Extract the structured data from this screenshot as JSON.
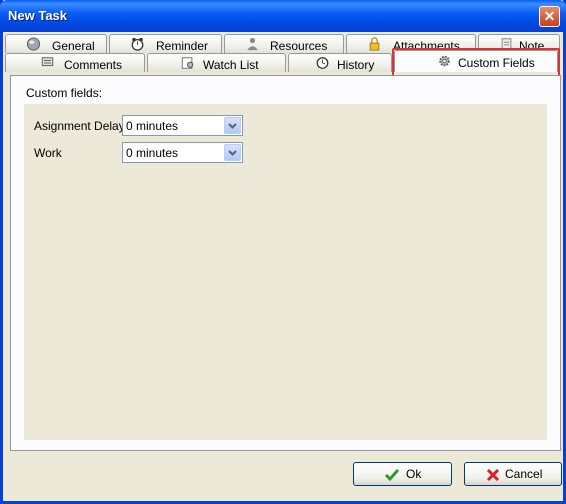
{
  "window": {
    "title": "New Task",
    "close_glyph": "✕"
  },
  "tabs": {
    "row1": [
      {
        "label": "General",
        "icon": "globe-icon"
      },
      {
        "label": "Reminder",
        "icon": "alarm-clock-icon"
      },
      {
        "label": "Resources",
        "icon": "person-icon"
      },
      {
        "label": "Attachments",
        "icon": "padlock-icon"
      },
      {
        "label": "Note",
        "icon": "note-icon"
      }
    ],
    "row2": [
      {
        "label": "Comments",
        "icon": "comments-icon"
      },
      {
        "label": "Watch List",
        "icon": "watch-list-icon"
      },
      {
        "label": "History",
        "icon": "history-icon"
      },
      {
        "label": "Custom Fields",
        "icon": "gear-icon",
        "active": true
      }
    ]
  },
  "panel": {
    "label": "Custom fields:"
  },
  "fields": [
    {
      "label": "Asignment Delay",
      "value": "0 minutes"
    },
    {
      "label": "Work",
      "value": "0 minutes"
    }
  ],
  "buttons": {
    "ok": "Ok",
    "cancel": "Cancel"
  },
  "colors": {
    "titlebar": "#0a5ef5",
    "highlight": "#e03030",
    "ok_check": "#2e9a2e",
    "cancel_x": "#d42020"
  }
}
